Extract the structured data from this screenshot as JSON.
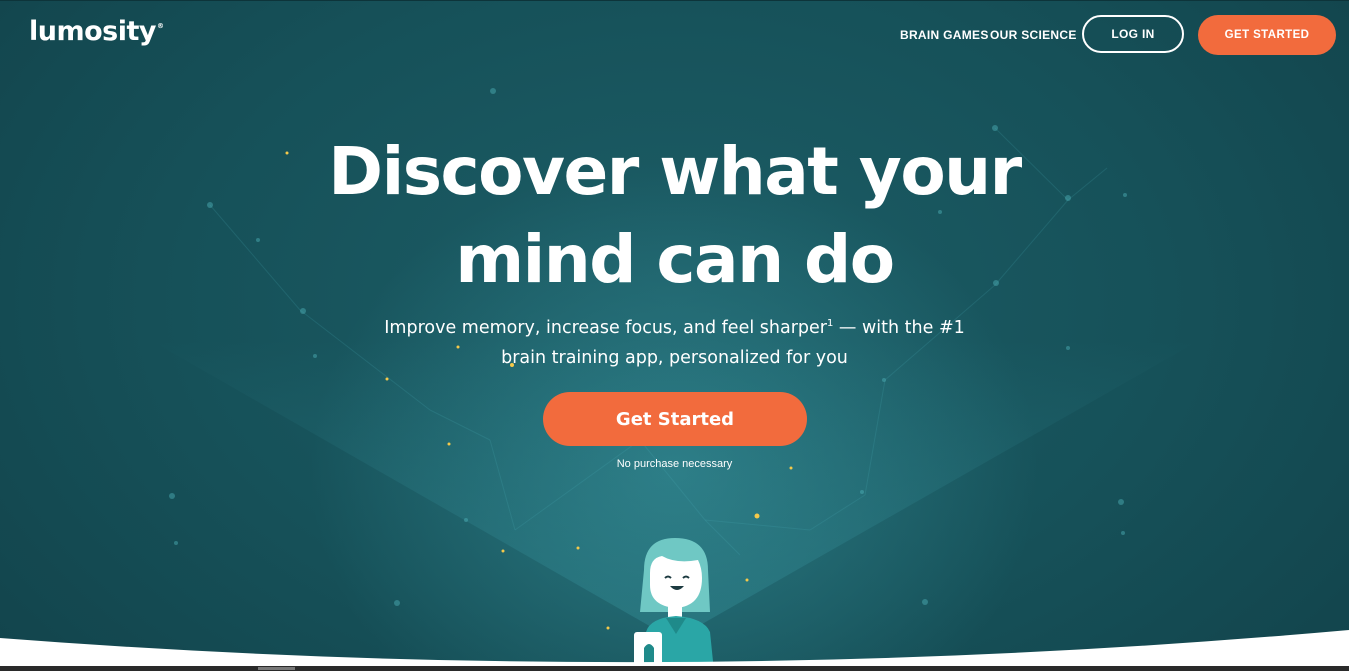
{
  "brand": {
    "name": "lumosity",
    "registered_mark": "®"
  },
  "nav": {
    "brain_games": "BRAIN GAMES",
    "our_science": "OUR SCIENCE",
    "log_in": "LOG IN",
    "get_started": "GET STARTED"
  },
  "hero": {
    "headline_line1": "Discover what your",
    "headline_line2": "mind can do",
    "sub_line1_pre": "Improve memory, increase focus, and feel sharper",
    "sub_footnote": "1",
    "sub_line1_post": " — with the #1",
    "sub_line2": "brain training app, personalized for you",
    "cta_label": "Get Started",
    "note": "No purchase necessary"
  },
  "colors": {
    "background": "#14474f",
    "accent": "#f26b3d",
    "character_hair": "#6fc8c4",
    "character_shirt": "#2aa6a6"
  },
  "icons": [
    "lumosity-logo",
    "brain-character-illustration"
  ]
}
